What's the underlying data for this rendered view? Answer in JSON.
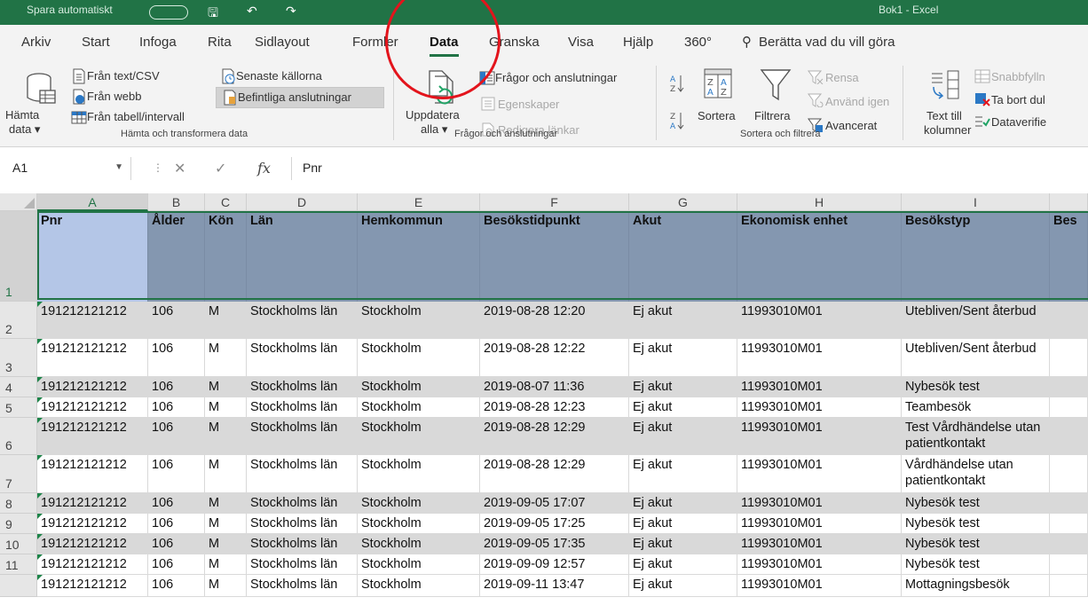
{
  "titlebar": {
    "autosave": "Spara automatiskt",
    "filename": "Bok1 - Excel"
  },
  "menu": {
    "tabs": [
      "Arkiv",
      "Start",
      "Infoga",
      "Rita",
      "Sidlayout",
      "Formler",
      "Data",
      "Granska",
      "Visa",
      "Hjälp",
      "360°"
    ],
    "active": "Data",
    "tell_me": "Berätta vad du vill göra"
  },
  "ribbon": {
    "get_data": {
      "hamta_line1": "Hämta",
      "hamta_line2": "data",
      "fran_text": "Från text/CSV",
      "fran_webb": "Från webb",
      "fran_tabell": "Från tabell/intervall",
      "senaste": "Senaste källorna",
      "befintliga": "Befintliga anslutningar",
      "label": "Hämta och transformera data"
    },
    "queries": {
      "uppdatera_line1": "Uppdatera",
      "uppdatera_line2": "alla",
      "fragor": "Frågor och anslutningar",
      "egenskaper": "Egenskaper",
      "redigera": "Redigera länkar",
      "label": "Frågor och anslutningar"
    },
    "sort": {
      "sortera": "Sortera",
      "filtrera": "Filtrera",
      "rensa": "Rensa",
      "anvand_igen": "Använd igen",
      "avancerat": "Avancerat",
      "label": "Sortera och filtrera"
    },
    "tools": {
      "text_till_line1": "Text till",
      "text_till_line2": "kolumner",
      "snabbfyll": "Snabbfylln",
      "ta_bort": "Ta bort dul",
      "dataverif": "Dataverifie"
    }
  },
  "formula_bar": {
    "name_box": "A1",
    "fx": "fx",
    "value": "Pnr"
  },
  "grid": {
    "columns": [
      "A",
      "B",
      "C",
      "D",
      "E",
      "F",
      "G",
      "H",
      "I",
      ""
    ],
    "headers": [
      "Pnr",
      "Ålder",
      "Kön",
      "Län",
      "Hemkommun",
      "Besökstidpunkt",
      "Akut",
      "Ekonomisk enhet",
      "Besökstyp",
      "Bes"
    ],
    "rows": [
      {
        "n": "2",
        "c": [
          "191212121212",
          "106",
          "M",
          "Stockholms län",
          "Stockholm",
          "2019-08-28 12:20",
          "Ej akut",
          "11993010M01",
          "Utebliven/Sent återbud"
        ]
      },
      {
        "n": "3",
        "c": [
          "191212121212",
          "106",
          "M",
          "Stockholms län",
          "Stockholm",
          "2019-08-28 12:22",
          "Ej akut",
          "11993010M01",
          "Utebliven/Sent återbud"
        ]
      },
      {
        "n": "4",
        "c": [
          "191212121212",
          "106",
          "M",
          "Stockholms län",
          "Stockholm",
          "2019-08-07 11:36",
          "Ej akut",
          "11993010M01",
          "Nybesök test"
        ]
      },
      {
        "n": "5",
        "c": [
          "191212121212",
          "106",
          "M",
          "Stockholms län",
          "Stockholm",
          "2019-08-28 12:23",
          "Ej akut",
          "11993010M01",
          "Teambesök"
        ]
      },
      {
        "n": "6",
        "c": [
          "191212121212",
          "106",
          "M",
          "Stockholms län",
          "Stockholm",
          "2019-08-28 12:29",
          "Ej akut",
          "11993010M01",
          "Test Vårdhändelse utan patientkontakt"
        ]
      },
      {
        "n": "7",
        "c": [
          "191212121212",
          "106",
          "M",
          "Stockholms län",
          "Stockholm",
          "2019-08-28 12:29",
          "Ej akut",
          "11993010M01",
          "Vårdhändelse utan patientkontakt"
        ]
      },
      {
        "n": "8",
        "c": [
          "191212121212",
          "106",
          "M",
          "Stockholms län",
          "Stockholm",
          "2019-09-05 17:07",
          "Ej akut",
          "11993010M01",
          "Nybesök test"
        ]
      },
      {
        "n": "9",
        "c": [
          "191212121212",
          "106",
          "M",
          "Stockholms län",
          "Stockholm",
          "2019-09-05 17:25",
          "Ej akut",
          "11993010M01",
          "Nybesök test"
        ]
      },
      {
        "n": "10",
        "c": [
          "191212121212",
          "106",
          "M",
          "Stockholms län",
          "Stockholm",
          "2019-09-05 17:35",
          "Ej akut",
          "11993010M01",
          "Nybesök test"
        ]
      },
      {
        "n": "11",
        "c": [
          "191212121212",
          "106",
          "M",
          "Stockholms län",
          "Stockholm",
          "2019-09-09 12:57",
          "Ej akut",
          "11993010M01",
          "Nybesök test"
        ]
      },
      {
        "n": "",
        "c": [
          "191212121212",
          "106",
          "M",
          "Stockholms län",
          "Stockholm",
          "2019-09-11 13:47",
          "Ej akut",
          "11993010M01",
          "Mottagningsbesök"
        ]
      }
    ]
  },
  "colors": {
    "excel_green": "#217346",
    "header_fill": "#8497b0",
    "row_shade": "#d9d9d9",
    "annotation_red": "#e3141c"
  }
}
